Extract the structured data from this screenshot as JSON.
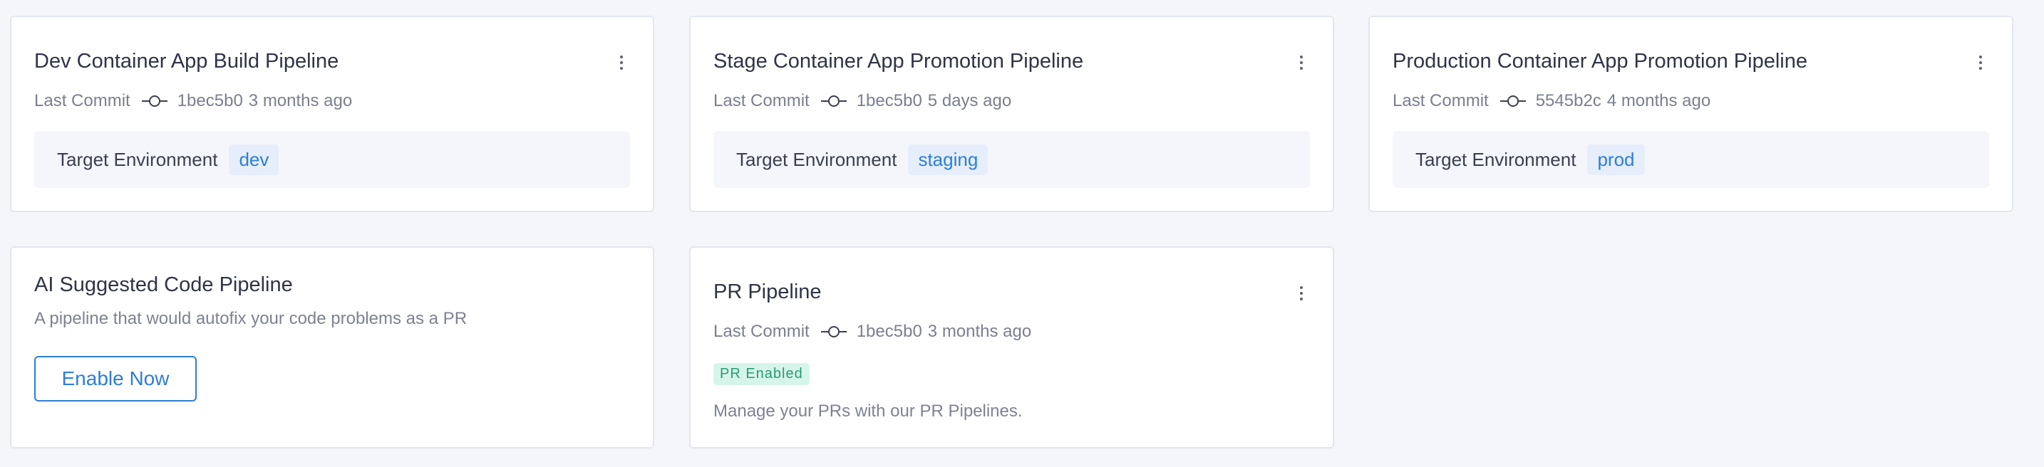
{
  "cards": [
    {
      "title": "Dev Container App Build Pipeline",
      "last_commit_label": "Last Commit",
      "commit_hash": "1bec5b0",
      "commit_time": "3 months ago",
      "target_env_label": "Target Environment",
      "target_env_value": "dev"
    },
    {
      "title": "Stage Container App Promotion Pipeline",
      "last_commit_label": "Last Commit",
      "commit_hash": "1bec5b0",
      "commit_time": "5 days ago",
      "target_env_label": "Target Environment",
      "target_env_value": "staging"
    },
    {
      "title": "Production Container App Promotion Pipeline",
      "last_commit_label": "Last Commit",
      "commit_hash": "5545b2c",
      "commit_time": "4 months ago",
      "target_env_label": "Target Environment",
      "target_env_value": "prod"
    }
  ],
  "ai_card": {
    "title": "AI Suggested Code Pipeline",
    "description": "A pipeline that would autofix your code problems as a PR",
    "button_label": "Enable Now"
  },
  "pr_card": {
    "title": "PR Pipeline",
    "last_commit_label": "Last Commit",
    "commit_hash": "1bec5b0",
    "commit_time": "3 months ago",
    "badge": "PR Enabled",
    "description": "Manage your PRs with our PR Pipelines."
  },
  "icons": {
    "menu": "more-vertical-icon",
    "commit": "git-commit-icon"
  },
  "colors": {
    "accent": "#2e7ed6",
    "badge_bg": "#e5eefa",
    "pr_badge_bg": "#d6f5ea",
    "pr_badge_text": "#2a9a72"
  }
}
